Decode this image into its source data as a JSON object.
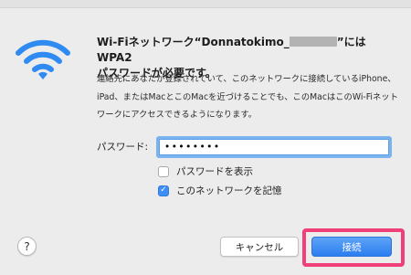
{
  "title": {
    "prefix": "Wi-Fiネットワーク“Donnatokimo_",
    "suffix": "”にはWPA2",
    "line2": "パスワードが必要です。"
  },
  "description": "連絡先にあなたが登録されていて、このネットワークに接続しているiPhone、iPad、またはMacとこのMacを近づけることでも、このMacはこのWi-Fiネットワークにアクセスできるようになります。",
  "password": {
    "label": "パスワード:",
    "value_masked": "••••••••"
  },
  "options": {
    "show_password": {
      "label": "パスワードを表示",
      "checked": false
    },
    "remember_network": {
      "label": "このネットワークを記憶",
      "checked": true,
      "mark": "✓"
    }
  },
  "buttons": {
    "help": "?",
    "cancel": "キャンセル",
    "connect": "接続"
  },
  "colors": {
    "accent": "#2c7ef0",
    "wifi_icon": "#2f8bf2",
    "highlight": "#f0407a"
  },
  "icons": {
    "wifi": "wifi-icon"
  }
}
